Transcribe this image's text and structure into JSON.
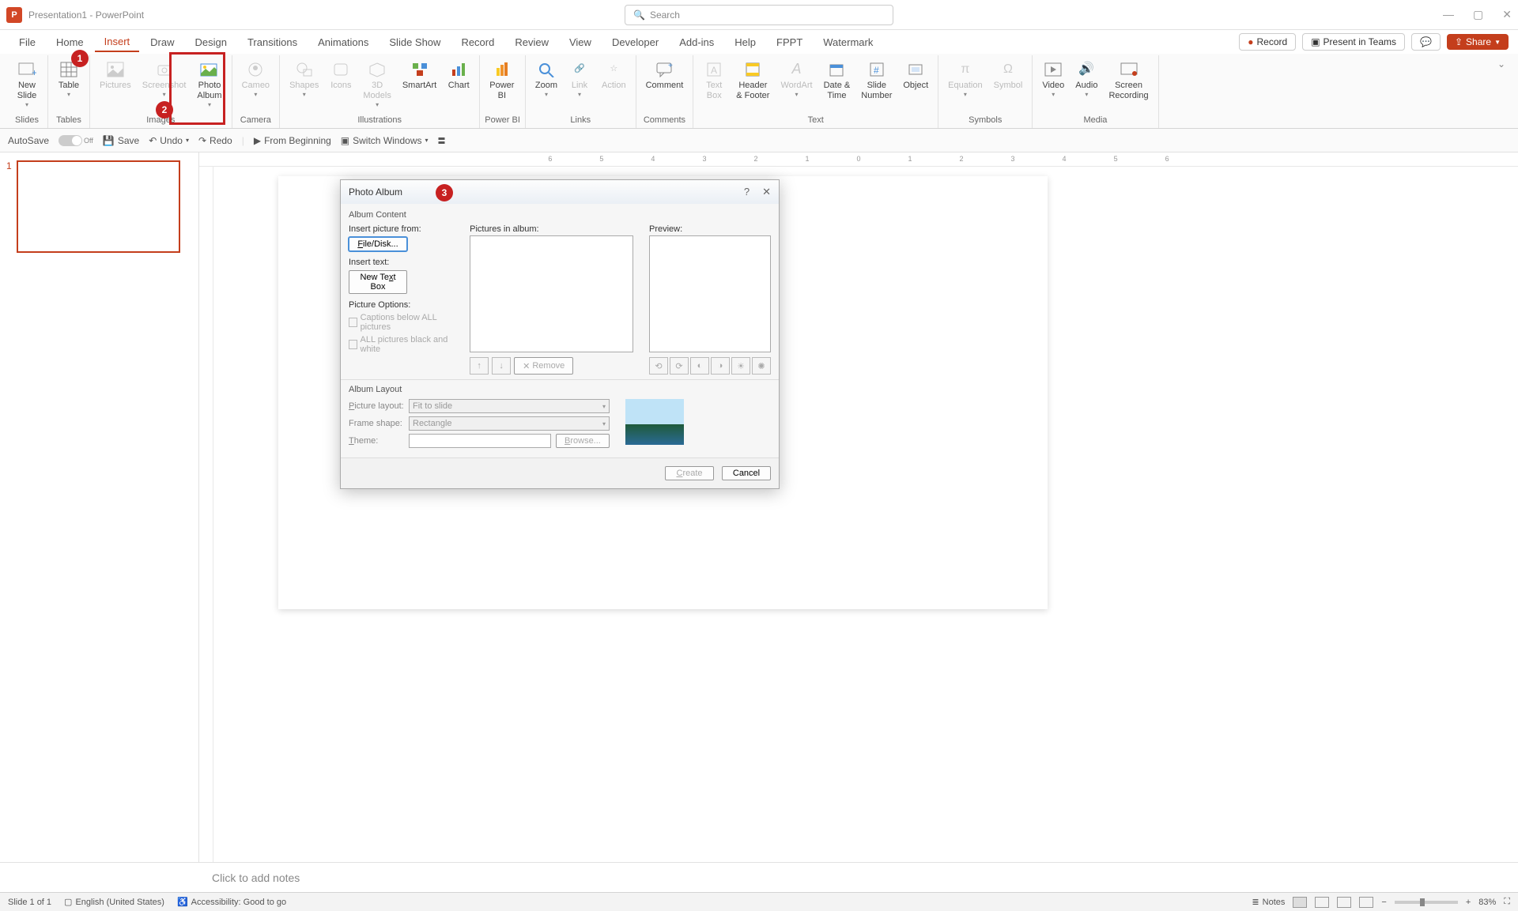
{
  "titlebar": {
    "app_letter": "P",
    "doc_title": "Presentation1 - PowerPoint",
    "search_placeholder": "Search"
  },
  "menu_tabs": [
    "File",
    "Home",
    "Insert",
    "Draw",
    "Design",
    "Transitions",
    "Animations",
    "Slide Show",
    "Record",
    "Review",
    "View",
    "Developer",
    "Add-ins",
    "Help",
    "FPPT",
    "Watermark"
  ],
  "menu_active": 2,
  "top_right": {
    "record": "Record",
    "present": "Present in Teams",
    "share": "Share"
  },
  "ribbon_groups": [
    {
      "label": "Slides",
      "items": [
        {
          "name": "new-slide",
          "label": "New\nSlide",
          "caret": true
        }
      ]
    },
    {
      "label": "Tables",
      "items": [
        {
          "name": "table",
          "label": "Table",
          "caret": true
        }
      ]
    },
    {
      "label": "Images",
      "items": [
        {
          "name": "pictures",
          "label": "Pictures",
          "disabled": true
        },
        {
          "name": "screenshot",
          "label": "Screenshot",
          "caret": true,
          "disabled": true
        },
        {
          "name": "photo-album",
          "label": "Photo\nAlbum",
          "caret": true
        }
      ]
    },
    {
      "label": "Camera",
      "items": [
        {
          "name": "cameo",
          "label": "Cameo",
          "caret": true,
          "disabled": true
        }
      ]
    },
    {
      "label": "Illustrations",
      "items": [
        {
          "name": "shapes",
          "label": "Shapes",
          "caret": true,
          "disabled": true
        },
        {
          "name": "icons",
          "label": "Icons",
          "disabled": true
        },
        {
          "name": "models3d",
          "label": "3D\nModels",
          "caret": true,
          "disabled": true
        },
        {
          "name": "smartart",
          "label": "SmartArt"
        },
        {
          "name": "chart",
          "label": "Chart"
        }
      ]
    },
    {
      "label": "Power BI",
      "items": [
        {
          "name": "powerbi",
          "label": "Power\nBI"
        }
      ]
    },
    {
      "label": "Links",
      "items": [
        {
          "name": "zoom",
          "label": "Zoom",
          "caret": true
        },
        {
          "name": "link",
          "label": "Link",
          "caret": true,
          "disabled": true
        },
        {
          "name": "action",
          "label": "Action",
          "disabled": true
        }
      ]
    },
    {
      "label": "Comments",
      "items": [
        {
          "name": "comment",
          "label": "Comment"
        }
      ]
    },
    {
      "label": "Text",
      "items": [
        {
          "name": "textbox",
          "label": "Text\nBox",
          "disabled": true
        },
        {
          "name": "headerfooter",
          "label": "Header\n& Footer"
        },
        {
          "name": "wordart",
          "label": "WordArt",
          "caret": true,
          "disabled": true
        },
        {
          "name": "datetime",
          "label": "Date &\nTime"
        },
        {
          "name": "slidenumber",
          "label": "Slide\nNumber"
        },
        {
          "name": "object",
          "label": "Object"
        }
      ]
    },
    {
      "label": "Symbols",
      "items": [
        {
          "name": "equation",
          "label": "Equation",
          "caret": true,
          "disabled": true
        },
        {
          "name": "symbol",
          "label": "Symbol",
          "disabled": true
        }
      ]
    },
    {
      "label": "Media",
      "items": [
        {
          "name": "video",
          "label": "Video",
          "caret": true
        },
        {
          "name": "audio",
          "label": "Audio",
          "caret": true
        },
        {
          "name": "screenrec",
          "label": "Screen\nRecording"
        }
      ]
    }
  ],
  "qat": {
    "autosave": "AutoSave",
    "autosave_state": "Off",
    "save": "Save",
    "undo": "Undo",
    "redo": "Redo",
    "from_beginning": "From Beginning",
    "switch_windows": "Switch Windows"
  },
  "slide_panel": {
    "slide_num": "1"
  },
  "ruler_marks": [
    "6",
    "5",
    "4",
    "3",
    "2",
    "1",
    "0",
    "1",
    "2",
    "3",
    "4",
    "5",
    "6"
  ],
  "notes_placeholder": "Click to add notes",
  "status": {
    "slide_of": "Slide 1 of 1",
    "language": "English (United States)",
    "accessibility": "Accessibility: Good to go",
    "notes": "Notes",
    "zoom": "83%"
  },
  "dialog": {
    "title": "Photo Album",
    "album_content": "Album Content",
    "insert_picture_from": "Insert picture from:",
    "file_disk": "File/Disk...",
    "insert_text": "Insert text:",
    "new_text_box": "New Text Box",
    "picture_options": "Picture Options:",
    "captions_below": "Captions below ALL pictures",
    "all_bw": "ALL pictures black and white",
    "pictures_in_album": "Pictures in album:",
    "preview": "Preview:",
    "remove": "Remove",
    "album_layout": "Album Layout",
    "picture_layout_label": "Picture layout:",
    "picture_layout_value": "Fit to slide",
    "frame_shape_label": "Frame shape:",
    "frame_shape_value": "Rectangle",
    "theme_label": "Theme:",
    "browse": "Browse...",
    "create": "Create",
    "cancel": "Cancel"
  },
  "callouts": {
    "c1": "1",
    "c2": "2",
    "c3": "3"
  }
}
